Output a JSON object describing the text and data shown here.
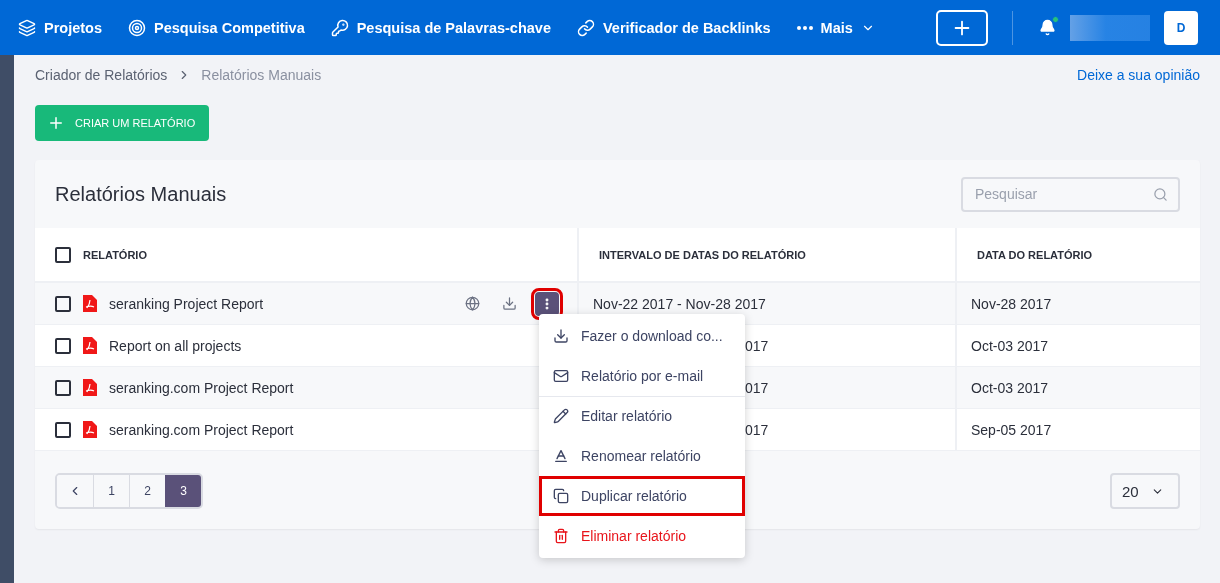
{
  "nav": {
    "items": [
      {
        "kind": "layers",
        "label": "Projetos"
      },
      {
        "kind": "target",
        "label": "Pesquisa Competitiva"
      },
      {
        "kind": "key",
        "label": "Pesquisa de Palavras-chave"
      },
      {
        "kind": "link",
        "label": "Verificador de Backlinks"
      },
      {
        "kind": "more",
        "label": "Mais"
      }
    ],
    "notification_dot": true,
    "avatar": "D"
  },
  "breadcrumb": [
    {
      "label": "Criador de Relatórios",
      "current": false
    },
    {
      "label": "Relatórios Manuais",
      "current": true
    }
  ],
  "feedback_link": "Deixe a sua opinião",
  "create_button": "CRIAR UM RELATÓRIO",
  "card": {
    "title": "Relatórios Manuais",
    "search": {
      "placeholder": "Pesquisar"
    }
  },
  "table": {
    "columns": [
      "RELATÓRIO",
      "INTERVALO DE DATAS DO RELATÓRIO",
      "DATA DO RELATÓRIO"
    ],
    "header_checked": false,
    "rows": [
      {
        "checked": false,
        "hovered": true,
        "name": "seranking Project Report",
        "range": "Nov-22 2017 - Nov-28 2017",
        "range_covered": false,
        "date": "Nov-28 2017"
      },
      {
        "checked": false,
        "hovered": false,
        "name": "Report on all projects",
        "range": "017",
        "range_covered": true,
        "date": "Oct-03 2017"
      },
      {
        "checked": false,
        "hovered": false,
        "name": "seranking.com Project Report",
        "range": "017",
        "range_covered": true,
        "date": "Oct-03 2017"
      },
      {
        "checked": false,
        "hovered": false,
        "name": "seranking.com Project Report",
        "range": "017",
        "range_covered": true,
        "date": "Sep-05 2017"
      }
    ]
  },
  "menu": {
    "button_highlighted": true,
    "items": [
      {
        "kind": "download",
        "label": "Fazer o download co...",
        "divider_before": false,
        "danger": false,
        "highlighted": false
      },
      {
        "kind": "email",
        "label": "Relatório por e-mail",
        "divider_before": false,
        "danger": false,
        "highlighted": false
      },
      {
        "kind": "edit",
        "label": "Editar relatório",
        "divider_before": true,
        "danger": false,
        "highlighted": false
      },
      {
        "kind": "rename",
        "label": "Renomear relatório",
        "divider_before": false,
        "danger": false,
        "highlighted": false
      },
      {
        "kind": "duplicate",
        "label": "Duplicar relatório",
        "divider_before": false,
        "danger": false,
        "highlighted": true
      },
      {
        "kind": "delete",
        "label": "Eliminar relatório",
        "divider_before": false,
        "danger": true,
        "highlighted": false
      }
    ]
  },
  "pagination": {
    "pages": [
      {
        "label": "1",
        "selected": false
      },
      {
        "label": "2",
        "selected": false
      },
      {
        "label": "3",
        "selected": true
      }
    ],
    "per_page": "20"
  }
}
